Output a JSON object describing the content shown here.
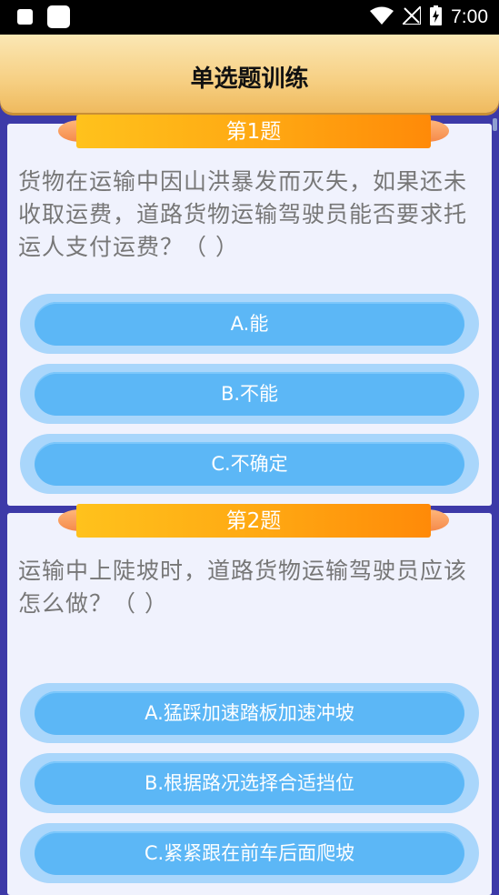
{
  "status_bar": {
    "time": "7:00",
    "icons": [
      "notification-square-icon",
      "notification-square-icon",
      "wifi-icon",
      "no-signal-icon",
      "battery-charging-icon"
    ]
  },
  "header": {
    "title": "单选题训练"
  },
  "questions": [
    {
      "label": "第1题",
      "text": "货物在运输中因山洪暴发而灭失，如果还未收取运费，道路货物运输驾驶员能否要求托运人支付运费？（ ）",
      "options": [
        "A.能",
        "B.不能",
        "C.不确定"
      ]
    },
    {
      "label": "第2题",
      "text": "运输中上陡坡时，道路货物运输驾驶员应该怎么做？（ ）",
      "options": [
        "A.猛踩加速踏板加速冲坡",
        "B.根据路况选择合适挡位",
        "C.紧紧跟在前车后面爬坡"
      ]
    }
  ],
  "colors": {
    "background": "#3d3aa8",
    "header": "#f6cf82",
    "banner": "#ffa712",
    "option": "#5cb7f6",
    "option_ring": "#a9d6fb",
    "card": "#f0f2fd"
  }
}
